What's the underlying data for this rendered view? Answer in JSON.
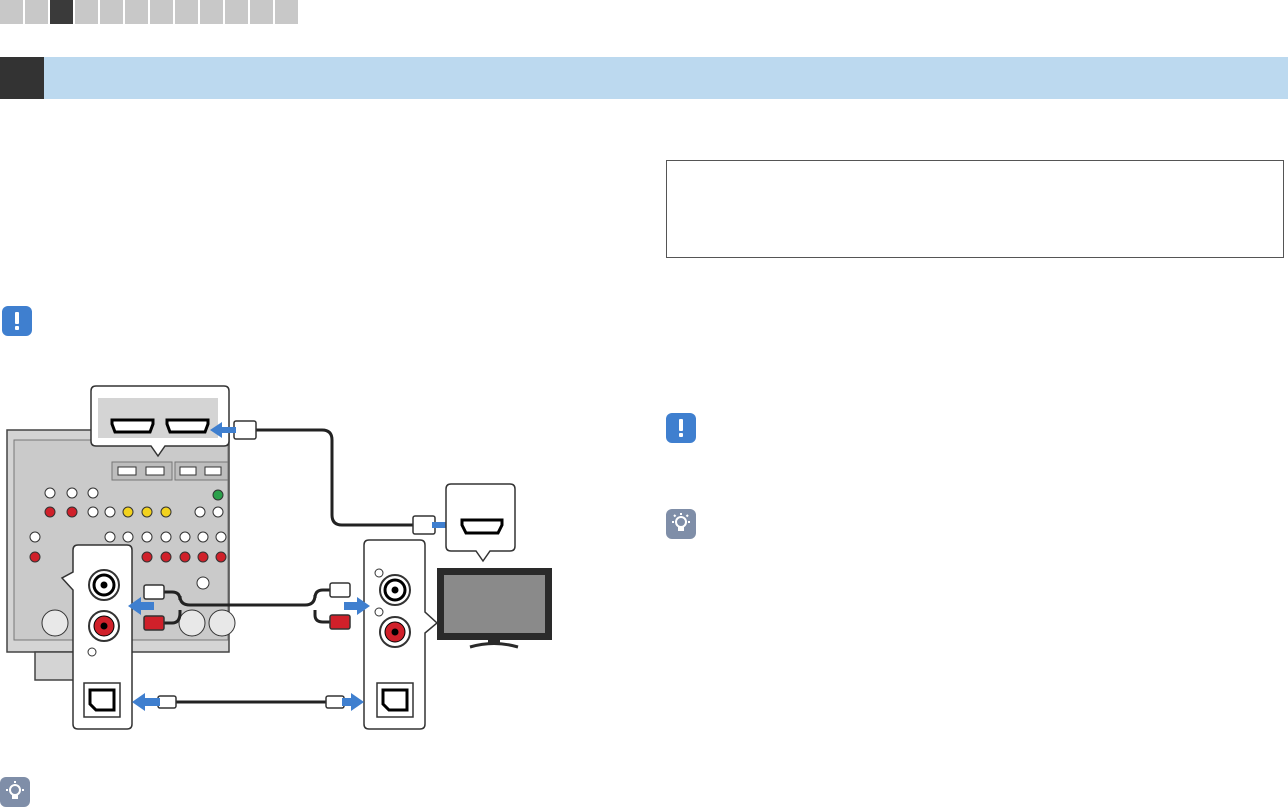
{
  "nav": {
    "cells": 12,
    "active_index": 2
  },
  "icons": {
    "caution_icon": "exclamation-caution-icon",
    "hint_icon": "lightbulb-hint-icon"
  },
  "colors": {
    "section_bar": "#bcd9ef",
    "section_block": "#333333",
    "arrow": "#3f7fcf",
    "caution": "#3f7fcf",
    "hint": "#7f8ea8",
    "rca_red": "#d0202a",
    "panel": "#cfcfcf",
    "tv_screen": "#8a8a8a"
  }
}
